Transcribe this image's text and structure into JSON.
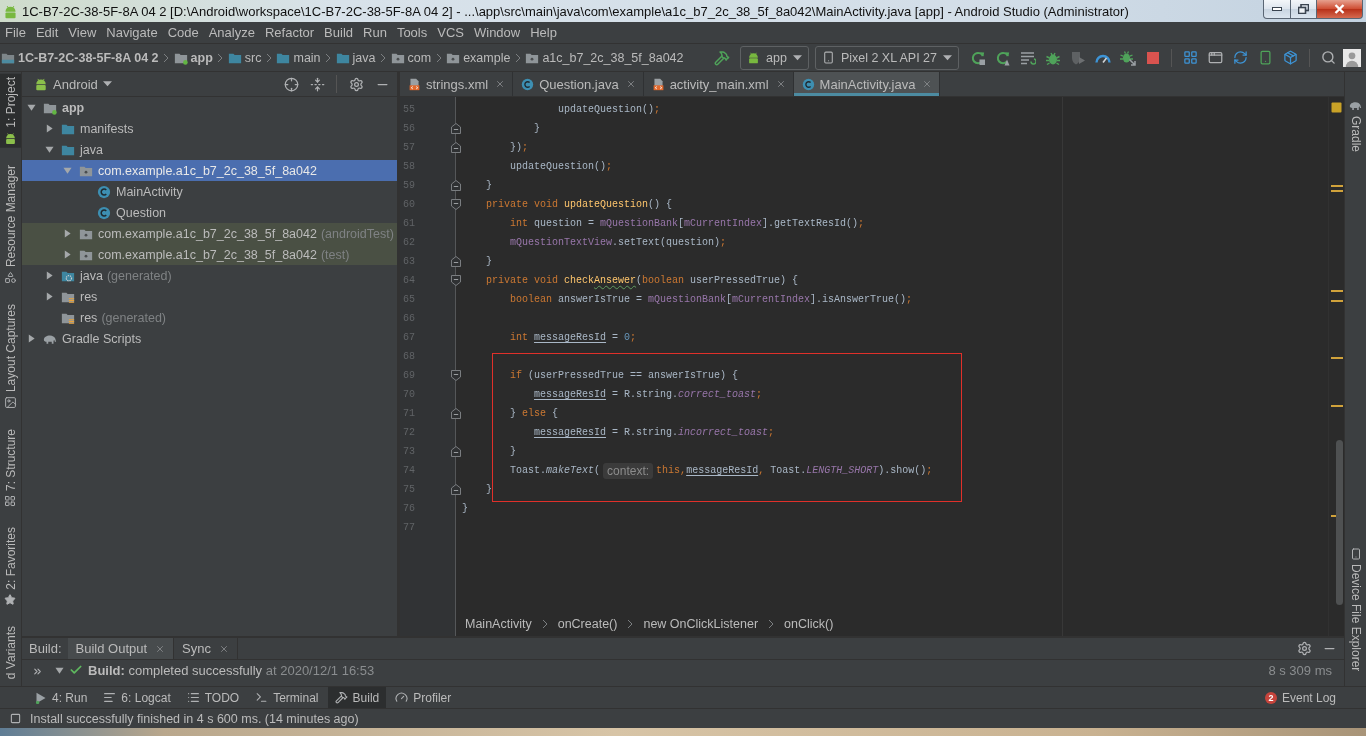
{
  "window": {
    "title": "1C-B7-2C-38-5F-8A 04 2 [D:\\Android\\workspace\\1C-B7-2C-38-5F-8A 04 2] - ...\\app\\src\\main\\java\\com\\example\\a1c_b7_2c_38_5f_8a042\\MainActivity.java [app] - Android Studio (Administrator)"
  },
  "menu": [
    "File",
    "Edit",
    "View",
    "Navigate",
    "Code",
    "Analyze",
    "Refactor",
    "Build",
    "Run",
    "Tools",
    "VCS",
    "Window",
    "Help"
  ],
  "navigation_bar": {
    "path": [
      {
        "label": "1C-B7-2C-38-5F-8A 04 2",
        "kind": "project"
      },
      {
        "label": "app",
        "kind": "module"
      },
      {
        "label": "src",
        "kind": "folder"
      },
      {
        "label": "main",
        "kind": "folder"
      },
      {
        "label": "java",
        "kind": "source_folder"
      },
      {
        "label": "com",
        "kind": "package"
      },
      {
        "label": "example",
        "kind": "package"
      },
      {
        "label": "a1c_b7_2c_38_5f_8a042",
        "kind": "package"
      }
    ],
    "run_configuration": "app",
    "device": "Pixel 2 XL API 27",
    "actions": [
      {
        "kind": "restart",
        "disabled": false
      },
      {
        "kind": "apply_code",
        "disabled": false
      },
      {
        "kind": "apply_changes",
        "disabled": false
      },
      {
        "kind": "debug",
        "disabled": false
      },
      {
        "kind": "coverage",
        "disabled": true
      },
      {
        "kind": "profile",
        "disabled": false
      },
      {
        "kind": "attach_debugger",
        "disabled": false
      },
      {
        "kind": "stop",
        "disabled": false
      }
    ]
  },
  "left_tool_windows": [
    {
      "label": "1: Project",
      "kind": "project",
      "selected": true
    },
    {
      "label": "Resource Manager",
      "kind": "resources",
      "selected": false
    },
    {
      "label": "Layout Captures",
      "kind": "captures",
      "selected": false
    },
    {
      "label": "7: Structure",
      "kind": "structure",
      "selected": false
    },
    {
      "label": "2: Favorites",
      "kind": "favorites",
      "selected": false
    },
    {
      "label": "d Variants",
      "selected": false
    }
  ],
  "project_panel": {
    "view": "Android",
    "tree": [
      {
        "label": "app",
        "kind": "module",
        "expanded": true,
        "selected": false,
        "children": [
          {
            "label": "manifests",
            "kind": "folder",
            "expanded": false,
            "selected": false
          },
          {
            "label": "java",
            "kind": "folder",
            "expanded": true,
            "selected": false,
            "children": [
              {
                "label": "com.example.a1c_b7_2c_38_5f_8a042",
                "kind": "package",
                "expanded": true,
                "selected": true,
                "children": [
                  {
                    "label": "MainActivity",
                    "kind": "class",
                    "selected": false
                  },
                  {
                    "label": "Question",
                    "kind": "class",
                    "selected": false
                  }
                ]
              },
              {
                "label": "com.example.a1c_b7_2c_38_5f_8a042",
                "note": "(androidTest)",
                "kind": "test_package",
                "expanded": false,
                "selected": false
              },
              {
                "label": "com.example.a1c_b7_2c_38_5f_8a042",
                "note": "(test)",
                "kind": "test_package",
                "expanded": false,
                "selected": false
              }
            ]
          },
          {
            "label": "java",
            "note": "(generated)",
            "kind": "generated_folder",
            "expanded": false,
            "selected": false
          },
          {
            "label": "res",
            "kind": "res_folder",
            "expanded": false,
            "selected": false
          },
          {
            "label": "res",
            "note": "(generated)",
            "kind": "res_folder",
            "selected": false
          }
        ]
      },
      {
        "label": "Gradle Scripts",
        "kind": "gradle",
        "expanded": false,
        "selected": false
      }
    ]
  },
  "editor": {
    "tabs": [
      {
        "label": "strings.xml",
        "kind": "xml",
        "selected": false
      },
      {
        "label": "Question.java",
        "kind": "class",
        "selected": false
      },
      {
        "label": "activity_main.xml",
        "kind": "xml",
        "selected": false
      },
      {
        "label": "MainActivity.java",
        "kind": "class",
        "selected": true
      }
    ],
    "lines": [
      {
        "number": "55",
        "kind": "plain",
        "tokens": [
          {
            "text": "                updateQuestion()",
            "kind": "plain"
          },
          {
            "text": ";",
            "kind": "separator"
          }
        ]
      },
      {
        "number": "56",
        "kind": "block_end",
        "tokens": [
          {
            "text": "            }",
            "kind": "plain"
          }
        ]
      },
      {
        "number": "57",
        "kind": "block_end",
        "tokens": [
          {
            "text": "        })",
            "kind": "plain"
          },
          {
            "text": ";",
            "kind": "separator"
          }
        ]
      },
      {
        "number": "58",
        "kind": "plain",
        "tokens": [
          {
            "text": "        updateQuestion()",
            "kind": "plain"
          },
          {
            "text": ";",
            "kind": "separator"
          }
        ]
      },
      {
        "number": "59",
        "kind": "block_end",
        "tokens": [
          {
            "text": "    }",
            "kind": "plain"
          }
        ]
      },
      {
        "number": "60",
        "kind": "block_start",
        "tokens": [
          {
            "text": "    private void ",
            "kind": "keyword"
          },
          {
            "text": "updateQuestion",
            "kind": "declaration"
          },
          {
            "text": "() {",
            "kind": "plain"
          }
        ]
      },
      {
        "number": "61",
        "kind": "plain",
        "tokens": [
          {
            "text": "        int ",
            "kind": "keyword"
          },
          {
            "text": "question = ",
            "kind": "plain"
          },
          {
            "text": "mQuestionBank",
            "kind": "field"
          },
          {
            "text": "[",
            "kind": "plain"
          },
          {
            "text": "mCurrentIndex",
            "kind": "field"
          },
          {
            "text": "].getTextResId()",
            "kind": "plain"
          },
          {
            "text": ";",
            "kind": "separator"
          }
        ]
      },
      {
        "number": "62",
        "kind": "plain",
        "tokens": [
          {
            "text": "        mQuestionTextView",
            "kind": "field"
          },
          {
            "text": ".setText(question)",
            "kind": "plain"
          },
          {
            "text": ";",
            "kind": "separator"
          }
        ]
      },
      {
        "number": "63",
        "kind": "block_end",
        "tokens": [
          {
            "text": "    }",
            "kind": "plain"
          }
        ]
      },
      {
        "number": "64",
        "kind": "block_start",
        "tokens": [
          {
            "text": "    private void ",
            "kind": "keyword"
          },
          {
            "text": "check",
            "kind": "declaration"
          },
          {
            "text": "Ansewer",
            "kind": "misspelled"
          },
          {
            "text": "(",
            "kind": "plain"
          },
          {
            "text": "boolean ",
            "kind": "keyword"
          },
          {
            "text": "userPressedTrue) {",
            "kind": "plain"
          }
        ]
      },
      {
        "number": "65",
        "kind": "plain",
        "tokens": [
          {
            "text": "        boolean ",
            "kind": "keyword"
          },
          {
            "text": "answerIsTrue = ",
            "kind": "plain"
          },
          {
            "text": "mQuestionBank",
            "kind": "field"
          },
          {
            "text": "[",
            "kind": "plain"
          },
          {
            "text": "mCurrentIndex",
            "kind": "field"
          },
          {
            "text": "].isAnswerTrue()",
            "kind": "plain"
          },
          {
            "text": ";",
            "kind": "separator"
          }
        ]
      },
      {
        "number": "66",
        "kind": "plain"
      },
      {
        "number": "67",
        "kind": "plain",
        "tokens": [
          {
            "text": "        int ",
            "kind": "keyword"
          },
          {
            "text": "messageResId",
            "kind": "reassigned"
          },
          {
            "text": " = ",
            "kind": "plain"
          },
          {
            "text": "0",
            "kind": "number"
          },
          {
            "text": ";",
            "kind": "separator"
          }
        ]
      },
      {
        "number": "68",
        "kind": "plain"
      },
      {
        "number": "69",
        "kind": "block_start",
        "tokens": [
          {
            "text": "        if ",
            "kind": "keyword"
          },
          {
            "text": "(userPressedTrue == answerIsTrue) {",
            "kind": "plain"
          }
        ]
      },
      {
        "number": "70",
        "kind": "plain",
        "tokens": [
          {
            "text": "            messageResId",
            "kind": "reassigned"
          },
          {
            "text": " = R.string.",
            "kind": "plain"
          },
          {
            "text": "correct_toast",
            "kind": "constant"
          },
          {
            "text": ";",
            "kind": "separator"
          }
        ]
      },
      {
        "number": "71",
        "kind": "block_end",
        "tokens": [
          {
            "text": "        } ",
            "kind": "plain"
          },
          {
            "text": "else ",
            "kind": "keyword"
          },
          {
            "text": "{",
            "kind": "plain"
          }
        ]
      },
      {
        "number": "72",
        "kind": "plain",
        "tokens": [
          {
            "text": "            messageResId",
            "kind": "reassigned"
          },
          {
            "text": " = R.string.",
            "kind": "plain"
          },
          {
            "text": "incorrect_toast",
            "kind": "constant"
          },
          {
            "text": ";",
            "kind": "separator"
          }
        ]
      },
      {
        "number": "73",
        "kind": "block_end",
        "tokens": [
          {
            "text": "        }",
            "kind": "plain"
          }
        ]
      },
      {
        "number": "74",
        "kind": "plain",
        "tokens": [
          {
            "text": "        Toast.",
            "kind": "plain"
          },
          {
            "text": "makeText",
            "kind": "static_call"
          },
          {
            "text": "(",
            "kind": "plain"
          },
          {
            "text": "context:",
            "kind": "hint"
          },
          {
            "text": "this",
            "kind": "keyword"
          },
          {
            "text": ",",
            "kind": "separator"
          },
          {
            "text": "messageResId",
            "kind": "reassigned"
          },
          {
            "text": ",",
            "kind": "separator"
          },
          {
            "text": " Toast.",
            "kind": "plain"
          },
          {
            "text": "LENGTH_SHORT",
            "kind": "constant"
          },
          {
            "text": ").show()",
            "kind": "plain"
          },
          {
            "text": ";",
            "kind": "separator"
          }
        ]
      },
      {
        "number": "75",
        "kind": "block_end",
        "tokens": [
          {
            "text": "    }",
            "kind": "plain"
          }
        ]
      },
      {
        "number": "76",
        "kind": "plain",
        "tokens": [
          {
            "text": "}",
            "kind": "plain"
          }
        ]
      },
      {
        "number": "77",
        "kind": "plain"
      }
    ],
    "breadcrumbs": [
      "MainActivity",
      "onCreate()",
      "new OnClickListener",
      "onClick()"
    ]
  },
  "right_tool_windows": [
    {
      "label": "Gradle",
      "kind": "gradle",
      "selected": false
    },
    {
      "label": "Device File Explorer",
      "kind": "device_explorer",
      "selected": false
    }
  ],
  "build_window": {
    "title": "Build:",
    "tabs": [
      {
        "label": "Build Output",
        "selected": true
      },
      {
        "label": "Sync",
        "selected": false
      }
    ],
    "entries": [
      {
        "expanded": true,
        "kind": "success",
        "label": "Build:",
        "message": "completed successfully",
        "time": "at 2020/12/1 16:53",
        "duration": "8 s 309 ms"
      }
    ]
  },
  "bottom_tool_windows": [
    {
      "label": "4: Run",
      "kind": "run",
      "selected": false
    },
    {
      "label": "6: Logcat",
      "kind": "logcat",
      "selected": false
    },
    {
      "label": "TODO",
      "kind": "todo",
      "selected": false
    },
    {
      "label": "Terminal",
      "kind": "terminal",
      "selected": false
    },
    {
      "label": "Build",
      "kind": "build",
      "selected": true
    },
    {
      "label": "Profiler",
      "kind": "profiler",
      "selected": false
    }
  ],
  "event_log": {
    "label": "Event Log",
    "count": "2"
  },
  "status_bar": {
    "message": "Install successfully finished in 4 s 600 ms. (14 minutes ago)"
  }
}
